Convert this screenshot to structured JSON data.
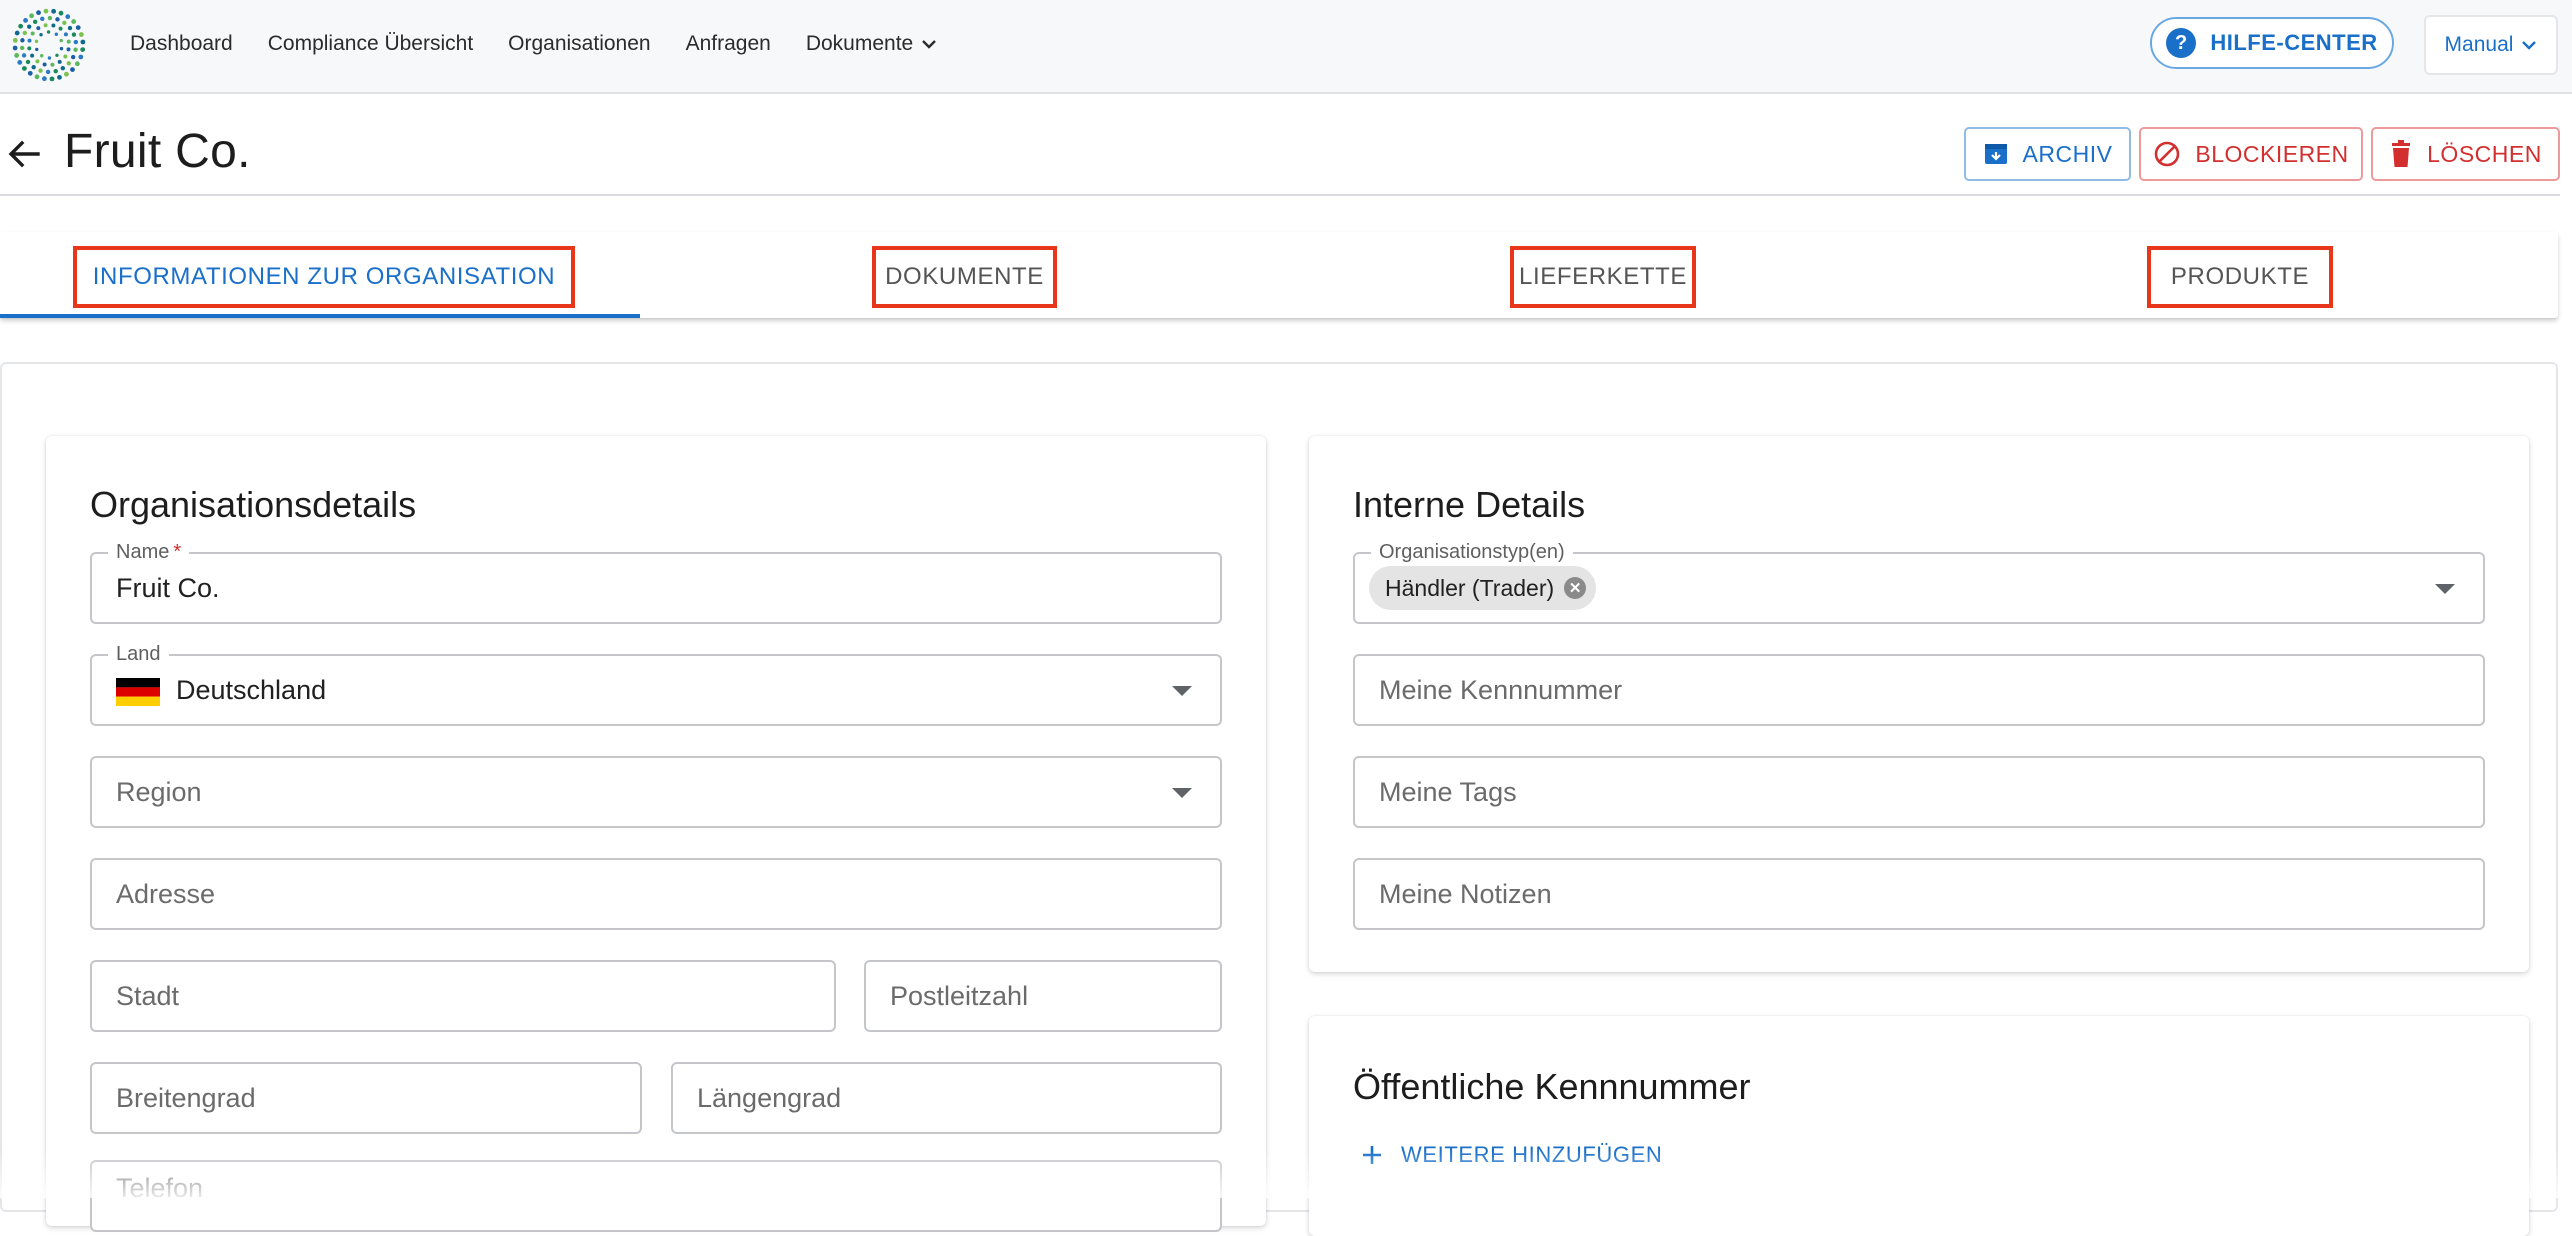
{
  "nav": {
    "logo": "company-logo",
    "items": [
      {
        "label": "Dashboard"
      },
      {
        "label": "Compliance Übersicht"
      },
      {
        "label": "Organisationen"
      },
      {
        "label": "Anfragen"
      },
      {
        "label": "Dokumente",
        "has_dropdown": true
      }
    ],
    "help_label": "HILFE-CENTER",
    "manual_label": "Manual"
  },
  "header": {
    "title": "Fruit Co.",
    "actions": {
      "archive_label": "ARCHIV",
      "block_label": "BLOCKIEREN",
      "delete_label": "LÖSCHEN"
    }
  },
  "tabs": [
    {
      "label": "INFORMATIONEN ZUR ORGANISATION",
      "active": true
    },
    {
      "label": "DOKUMENTE",
      "active": false
    },
    {
      "label": "LIEFERKETTE",
      "active": false
    },
    {
      "label": "PRODUKTE",
      "active": false
    }
  ],
  "org_details": {
    "title": "Organisationsdetails",
    "name": {
      "label": "Name",
      "required_mark": "*",
      "value": "Fruit Co."
    },
    "country": {
      "label": "Land",
      "value": "Deutschland",
      "flag": "germany-flag"
    },
    "region": {
      "placeholder": "Region"
    },
    "address": {
      "placeholder": "Adresse"
    },
    "city": {
      "placeholder": "Stadt"
    },
    "postal": {
      "placeholder": "Postleitzahl"
    },
    "latitude": {
      "placeholder": "Breitengrad"
    },
    "longitude": {
      "placeholder": "Längengrad"
    },
    "phone": {
      "placeholder": "Telefon"
    }
  },
  "internal_details": {
    "title": "Interne Details",
    "org_type": {
      "label": "Organisationstyp(en)",
      "chip": "Händler (Trader)"
    },
    "my_id": {
      "placeholder": "Meine Kennnummer"
    },
    "my_tags": {
      "placeholder": "Meine Tags"
    },
    "my_notes": {
      "placeholder": "Meine Notizen"
    }
  },
  "public_ids": {
    "title": "Öffentliche Kennnummer",
    "add_label": "WEITERE HINZUFÜGEN"
  },
  "colors": {
    "primary": "#1a6fc9",
    "danger": "#d32f2f",
    "highlight": "#e8361b"
  }
}
